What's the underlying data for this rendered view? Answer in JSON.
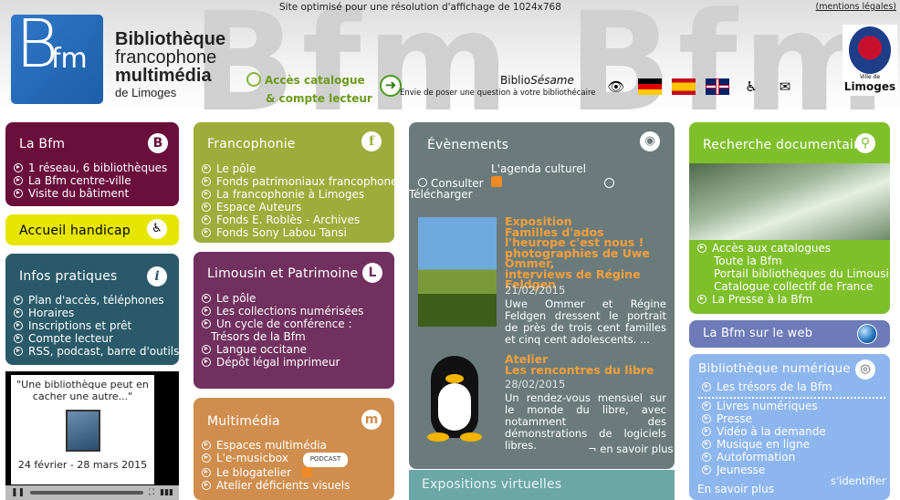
{
  "header": {
    "resolution_note": "Site optimisé pour une résolution d'affichage de 1024x768",
    "legal_link": "(mentions légales)",
    "watermark": "Bfm Bfm",
    "logo_letters": "Bfm",
    "title_line1": "Bibliothèque",
    "title_line2": "francophone",
    "title_line3": "multimédia",
    "title_line4": "de Limoges",
    "acces_line1": "Accès catalogue",
    "acces_line2": "& compte lecteur",
    "biblio_brand_a": "Biblio",
    "biblio_brand_b": "Sésame",
    "biblio_sub": "Envie de poser une question à votre bibliothécaire",
    "city_name": "Limoges",
    "city_small": "Ville de"
  },
  "col1": {
    "bfm_title": "La Bfm",
    "bfm_badge": "B",
    "bfm_items": [
      "1 réseau, 6 bibliothèques",
      "La Bfm centre-ville",
      "Visite du  bâtiment"
    ],
    "handicap_label": "Accueil handicap",
    "info_title": "Infos pratiques",
    "info_badge": "i",
    "info_items": [
      "Plan d'accès, téléphones",
      "Horaires",
      "Inscriptions et prêt",
      "Compte lecteur",
      "RSS, podcast,  barre d'outils"
    ],
    "video_quote_line1": "\"Une bibliothèque peut en",
    "video_quote_line2": "cacher une autre...\"",
    "video_dates": "24 février - 28 mars 2015"
  },
  "col2": {
    "franco_title": "Francophonie",
    "franco_badge": "f",
    "franco_items": [
      "Le pôle",
      "Fonds patrimoniaux francophones",
      "La francophonie à Limoges",
      "Espace Auteurs",
      "Fonds E. Roblès - Archives",
      "Fonds Sony Labou Tansi"
    ],
    "limousin_title": "Limousin et Patrimoine",
    "limousin_badge": "L",
    "limousin_items": [
      "Le pôle",
      "Les collections numérisées",
      "Un cycle de conférence :",
      "Langue occitane",
      "Dépôt légal imprimeur"
    ],
    "limousin_sub": "Trésors de la Bfm",
    "multi_title": "Multimédia",
    "multi_badge": "m",
    "multi_items": [
      "Espaces multimédia",
      "L'e-musicbox",
      "Le blogatelier",
      "Atelier déficients visuels"
    ],
    "podcast_label": "PODCAST"
  },
  "col3": {
    "events_title": "Évènements",
    "agenda_label": "L'agenda culturel",
    "consulter": "Consulter",
    "telecharger": "Télécharger",
    "event1_title_line1": "Exposition",
    "event1_title_line2": "Familles d'ados",
    "event1_title_line3": "l'heurope c'est nous !",
    "event1_title_line4": "photographies de Uwe",
    "event1_title_line5": "Ommer,",
    "event1_title_line6": "interviews de Régine",
    "event1_title_line7": "Feldgen",
    "event1_date": "21/02/2015",
    "event1_body": "Uwe Ommer et Régine Feldgen dressent le portrait de près de trois cent familles et cinq cent adolescents. ...",
    "event2_title_line1": "Atelier",
    "event2_title_line2": "Les rencontres du libre",
    "event2_date": "28/02/2015",
    "event2_body": "Un rendez-vous mensuel sur le monde du libre, avec notamment des démonstrations de logiciels libres.",
    "en_savoir_plus": "¬ en savoir plus",
    "expo_title": "Expositions virtuelles"
  },
  "col4": {
    "rech_title": "Recherche documentaire",
    "rech_item1": "Accès aux catalogues",
    "rech_sub1": "Toute la Bfm",
    "rech_sub2": "Portail bibliothèques du Limousin",
    "rech_sub3": "Catalogue collectif de France",
    "rech_item2": "La Presse à la Bfm",
    "web_title": "La Bfm sur le web",
    "num_title": "Bibliothèque numérique",
    "num_first": "Les trésors de la Bfm",
    "num_items": [
      "Livres numériques",
      "Presse",
      "Vidéo à la demande",
      "Musique en ligne",
      "Autoformation",
      "Jeunesse"
    ],
    "sidentifier": "s'identifier",
    "en_savoir_plus": "En savoir plus"
  }
}
